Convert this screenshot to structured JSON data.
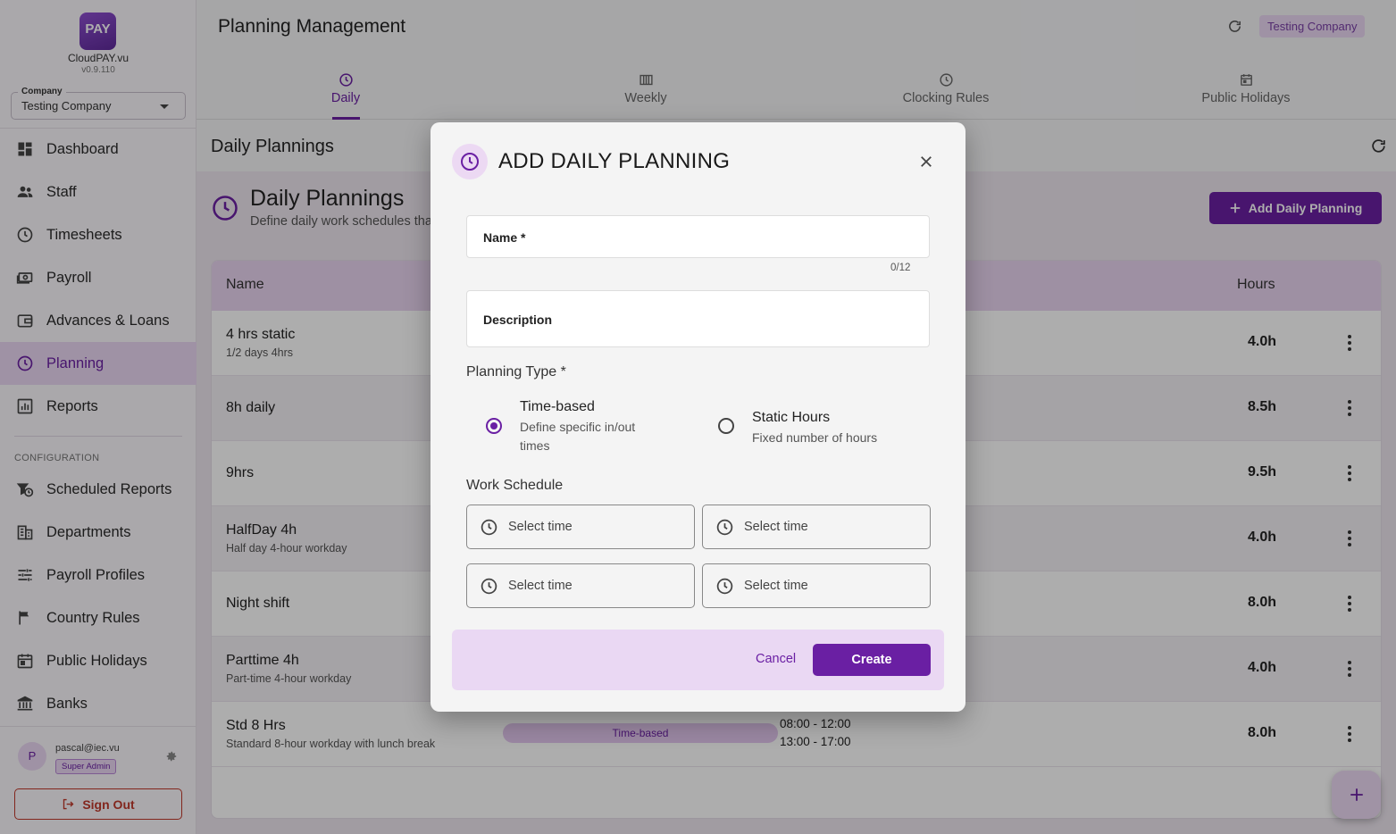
{
  "app": {
    "logo_text": "PAY",
    "brand_name": "CloudPAY.vu",
    "version": "v0.9.110"
  },
  "company_select": {
    "label": "Company",
    "value": "Testing Company"
  },
  "sidebar": {
    "items": [
      {
        "label": "Dashboard",
        "icon": "dashboard-icon"
      },
      {
        "label": "Staff",
        "icon": "people-icon"
      },
      {
        "label": "Timesheets",
        "icon": "clock-icon"
      },
      {
        "label": "Payroll",
        "icon": "money-icon"
      },
      {
        "label": "Advances & Loans",
        "icon": "wallet-icon"
      },
      {
        "label": "Planning",
        "icon": "clock-icon",
        "active": true
      },
      {
        "label": "Reports",
        "icon": "chart-icon"
      }
    ],
    "config_label": "CONFIGURATION",
    "config_items": [
      {
        "label": "Scheduled Reports",
        "icon": "scheduled-icon"
      },
      {
        "label": "Departments",
        "icon": "building-icon"
      },
      {
        "label": "Payroll Profiles",
        "icon": "sliders-icon"
      },
      {
        "label": "Country Rules",
        "icon": "flag-icon"
      },
      {
        "label": "Public Holidays",
        "icon": "calendar-icon"
      },
      {
        "label": "Banks",
        "icon": "bank-icon"
      }
    ],
    "user": {
      "initial": "P",
      "email": "pascal@iec.vu",
      "role": "Super Admin"
    },
    "sign_out": "Sign Out"
  },
  "header": {
    "title": "Planning Management",
    "company_chip": "Testing Company"
  },
  "tabs": [
    {
      "label": "Daily",
      "active": true
    },
    {
      "label": "Weekly"
    },
    {
      "label": "Clocking Rules"
    },
    {
      "label": "Public Holidays"
    }
  ],
  "section": {
    "title": "Daily Plannings",
    "heading": "Daily Plannings",
    "subtitle": "Define daily work schedules that",
    "add_button": "Add Daily Planning"
  },
  "table": {
    "headers": {
      "name": "Name",
      "hours": "Hours"
    },
    "rows": [
      {
        "name": "4 hrs static",
        "desc": "1/2 days 4hrs",
        "hours": "4.0h"
      },
      {
        "name": "8h daily",
        "desc": "",
        "hours": "8.5h"
      },
      {
        "name": "9hrs",
        "desc": "",
        "hours": "9.5h"
      },
      {
        "name": "HalfDay 4h",
        "desc": "Half day 4-hour workday",
        "hours": "4.0h"
      },
      {
        "name": "Night shift",
        "desc": "",
        "hours": "8.0h"
      },
      {
        "name": "Parttime 4h",
        "desc": "Part-time 4-hour workday",
        "hours": "4.0h"
      },
      {
        "name": "Std 8 Hrs",
        "desc": "Standard 8-hour workday with lunch break",
        "hours": "8.0h",
        "type": "Time-based",
        "time1": "08:00 - 12:00",
        "time2": "13:00 - 17:00"
      }
    ]
  },
  "modal": {
    "title": "ADD DAILY PLANNING",
    "name_label": "Name *",
    "name_counter": "0/12",
    "description_label": "Description",
    "planning_type_label": "Planning Type *",
    "options": [
      {
        "title": "Time-based",
        "desc_line1": "Define specific in/out",
        "desc_line2": "times",
        "checked": true
      },
      {
        "title": "Static Hours",
        "desc_line1": "Fixed number of hours",
        "checked": false
      }
    ],
    "work_schedule_label": "Work Schedule",
    "time_placeholder": "Select time",
    "cancel": "Cancel",
    "create": "Create"
  },
  "colors": {
    "primary": "#6a1fa3",
    "primary_light": "#ead8f3",
    "danger": "#c0392b"
  }
}
